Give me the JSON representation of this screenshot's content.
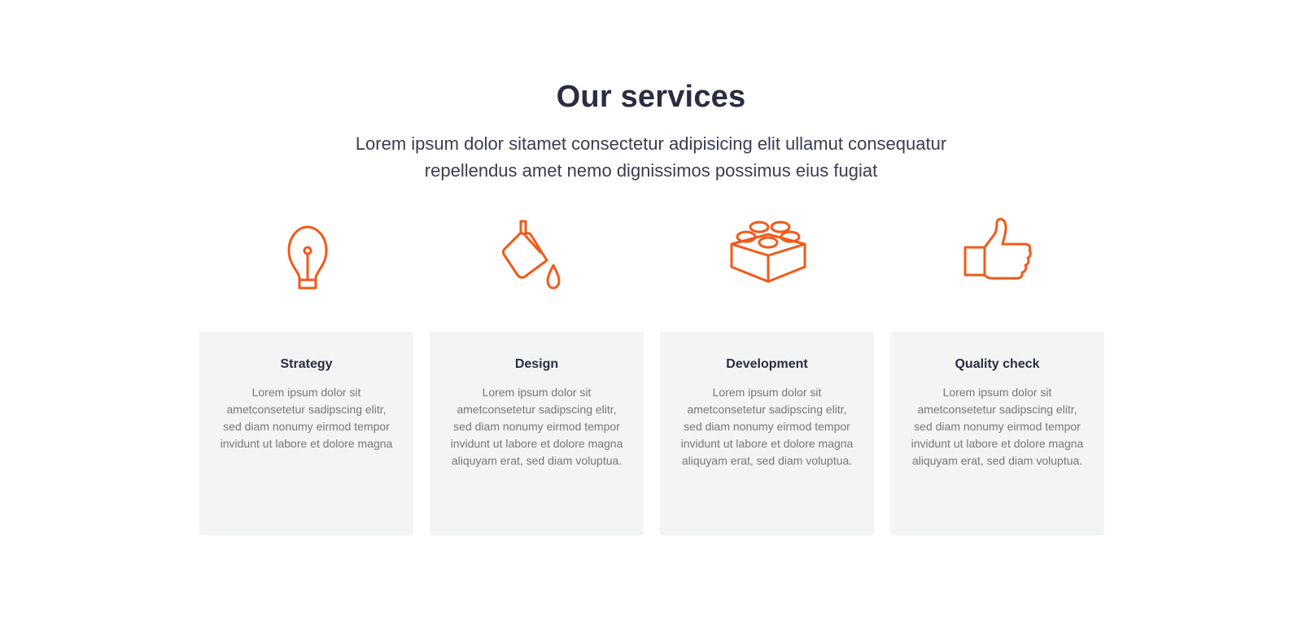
{
  "header": {
    "title": "Our services",
    "subtitle": "Lorem ipsum dolor sitamet consectetur adipisicing elit ullamut consequatur repellendus amet nemo dignissimos possimus eius fugiat"
  },
  "accent_color": "#f05a1a",
  "services": [
    {
      "icon": "lightbulb-icon",
      "title": "Strategy",
      "text": "Lorem ipsum dolor sit ametconsetetur sadipscing elitr, sed diam nonumy eirmod tempor invidunt ut labore et dolore magna"
    },
    {
      "icon": "paint-bucket-icon",
      "title": "Design",
      "text": "Lorem ipsum dolor sit ametconsetetur sadipscing elitr, sed diam nonumy eirmod tempor invidunt ut labore et dolore magna aliquyam erat, sed diam voluptua."
    },
    {
      "icon": "lego-brick-icon",
      "title": "Development",
      "text": "Lorem ipsum dolor sit ametconsetetur sadipscing elitr, sed diam nonumy eirmod tempor invidunt ut labore et dolore magna aliquyam erat, sed diam voluptua."
    },
    {
      "icon": "thumbs-up-icon",
      "title": "Quality check",
      "text": "Lorem ipsum dolor sit ametconsetetur sadipscing elitr, sed diam nonumy eirmod tempor invidunt ut labore et dolore magna aliquyam erat, sed diam voluptua."
    }
  ]
}
